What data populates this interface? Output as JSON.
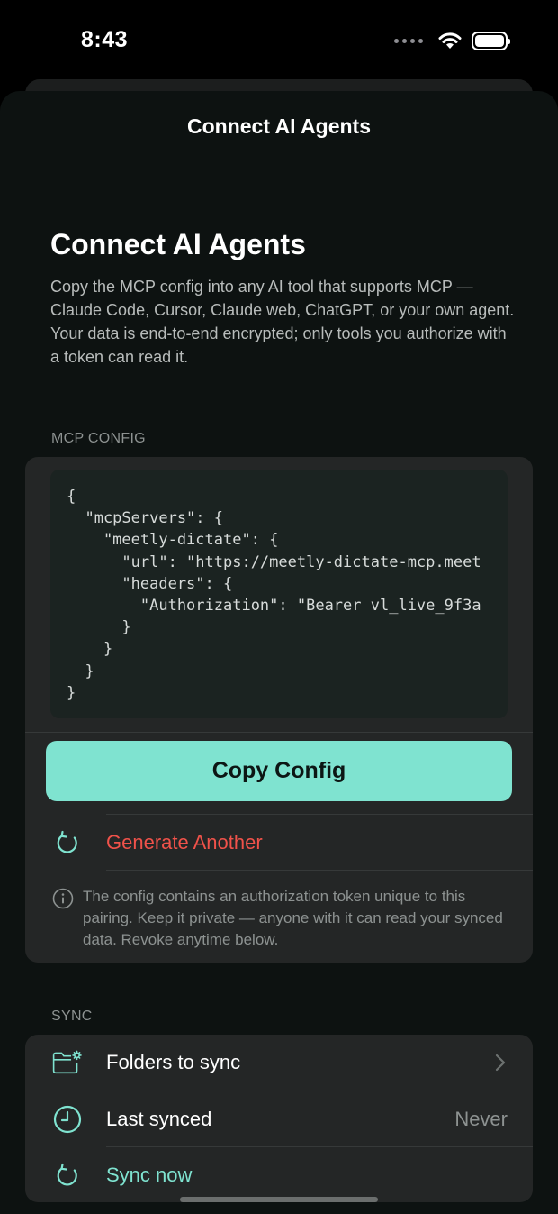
{
  "status_bar": {
    "time": "8:43"
  },
  "nav": {
    "title": "Connect AI Agents"
  },
  "header": {
    "heading": "Connect AI Agents",
    "intro": "Copy the MCP config into any AI tool that supports MCP — Claude Code, Cursor, Claude web, ChatGPT, or your own agent. Your data is end-to-end encrypted; only tools you authorize with a token can read it."
  },
  "mcp": {
    "section_label": "MCP CONFIG",
    "code": "{\n  \"mcpServers\": {\n    \"meetly-dictate\": {\n      \"url\": \"https://meetly-dictate-mcp.meet\n      \"headers\": {\n        \"Authorization\": \"Bearer vl_live_9f3a\n      }\n    }\n  }\n}",
    "copy_label": "Copy Config",
    "generate_label": "Generate Another",
    "note": "The config contains an authorization token unique to this pairing. Keep it private — anyone with it can read your synced data. Revoke anytime below."
  },
  "sync": {
    "section_label": "SYNC",
    "folders_label": "Folders to sync",
    "last_synced_label": "Last synced",
    "last_synced_value": "Never",
    "sync_now_label": "Sync now"
  },
  "colors": {
    "accent": "#7fe3d0",
    "destructive": "#f0524a",
    "background": "#0d1211",
    "card": "#242626"
  },
  "icons": [
    "wifi-icon",
    "battery-icon",
    "refresh-icon",
    "info-icon",
    "folder-gear-icon",
    "clock-icon",
    "chevron-right-icon"
  ]
}
